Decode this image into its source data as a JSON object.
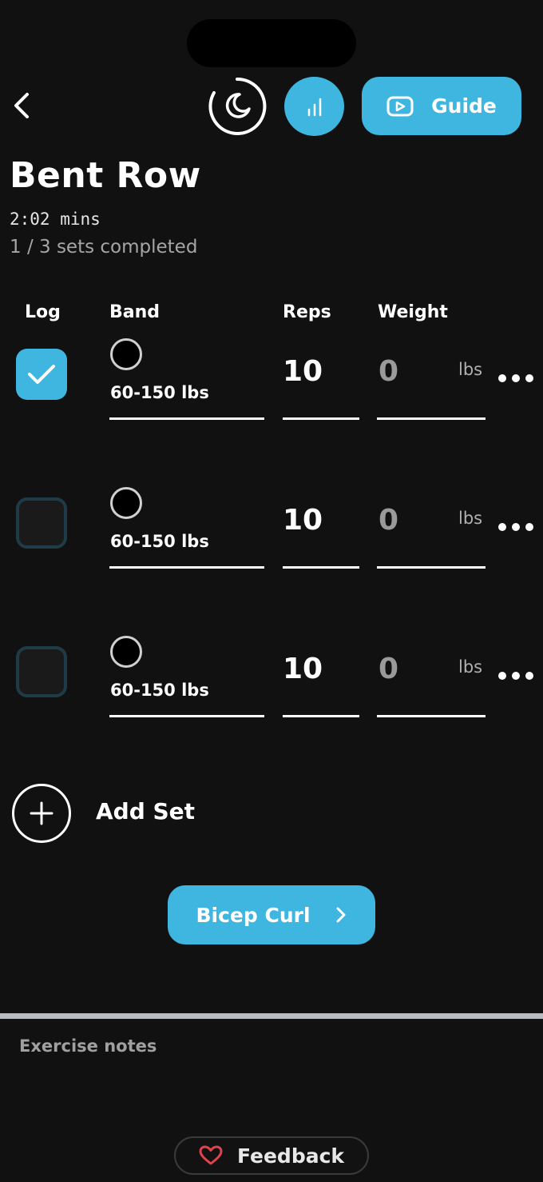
{
  "header": {
    "guide_label": "Guide"
  },
  "exercise": {
    "title": "Bent Row",
    "duration": "2:02 mins",
    "progress": "1 / 3 sets completed"
  },
  "columns": {
    "log": "Log",
    "band": "Band",
    "reps": "Reps",
    "weight": "Weight"
  },
  "sets": [
    {
      "logged": true,
      "band": "60-150 lbs",
      "reps": "10",
      "weight": "0",
      "unit": "lbs"
    },
    {
      "logged": false,
      "band": "60-150 lbs",
      "reps": "10",
      "weight": "0",
      "unit": "lbs"
    },
    {
      "logged": false,
      "band": "60-150 lbs",
      "reps": "10",
      "weight": "0",
      "unit": "lbs"
    }
  ],
  "add_set_label": "Add Set",
  "next_exercise_label": "Bicep Curl",
  "notes_label": "Exercise notes",
  "feedback_label": "Feedback",
  "colors": {
    "accent": "#3fb6e0",
    "background": "#111111",
    "heart": "#e0434a"
  },
  "icons": [
    "back-chevron-icon",
    "moon-timer-icon",
    "bar-chart-icon",
    "play-video-icon",
    "checkmark-icon",
    "plus-icon",
    "chevron-right-icon",
    "heart-icon",
    "more-dots-icon"
  ]
}
